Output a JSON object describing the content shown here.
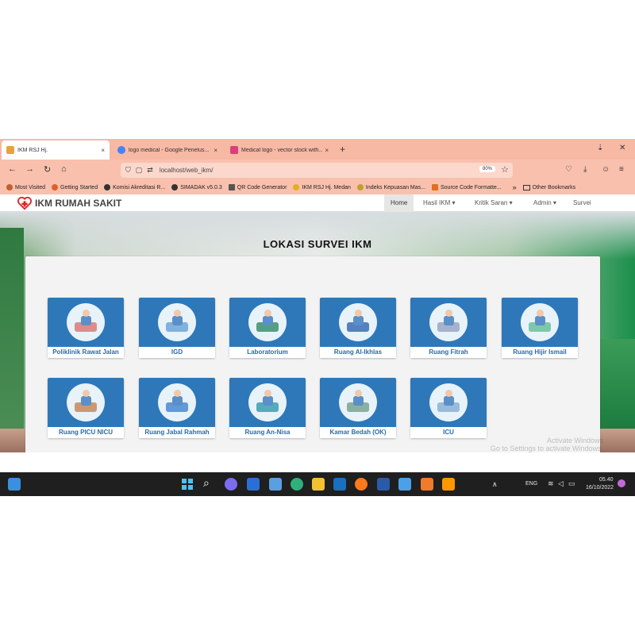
{
  "browser": {
    "tabs": [
      {
        "label": "IKM RSJ Hj.",
        "close": "×",
        "color": "#e8a33a"
      },
      {
        "label": "logo medical - Google Penelus...",
        "close": "×",
        "color": "#4285f4"
      },
      {
        "label": "Medical logo - vector stock with...",
        "close": "×",
        "color": "#d9407a"
      }
    ],
    "new_tab": "+",
    "window_controls": {
      "minimize": "⇣",
      "close": "✕"
    },
    "nav": {
      "back": "←",
      "forward": "→",
      "reload": "↻",
      "home": "⌂"
    },
    "url": "localhost/web_ikm/",
    "url_badge": "80%",
    "toolbar_icons": {
      "pocket": "♡",
      "download": "⤓",
      "extension": "☺",
      "menu": "≡"
    }
  },
  "bookmarks": {
    "items": [
      {
        "label": "Most Visited",
        "color": "#c06030"
      },
      {
        "label": "Getting Started",
        "color": "#e0602a"
      },
      {
        "label": "Komisi Akreditasi R...",
        "color": "#333333"
      },
      {
        "label": "SIMADAK v5.0.3",
        "color": "#333333"
      },
      {
        "label": "QR Code Generator",
        "color": "#555555"
      },
      {
        "label": "IKM RSJ Hj. Medan",
        "color": "#e0b020"
      },
      {
        "label": "Indeks Kepuasan Mas...",
        "color": "#c0a030"
      },
      {
        "label": "Source Code Formatte...",
        "color": "#e07020"
      }
    ],
    "more": "»",
    "other": "Other Bookmarks"
  },
  "site": {
    "brand": "IKM RUMAH SAKIT",
    "nav": [
      {
        "label": "Home"
      },
      {
        "label": "Hasil IKM ▾"
      },
      {
        "label": "Kritik Saran ▾"
      },
      {
        "label": "Admin ▾"
      },
      {
        "label": "Survei"
      }
    ],
    "title": "LOKASI SURVEI IKM",
    "watermark": "Activate Windows\nGo to Settings to activate Windows.",
    "cards": [
      {
        "label": "Poliklinik Rawat Jalan",
        "icon": "wheelchair-nurse"
      },
      {
        "label": "IGD",
        "icon": "emergency-room"
      },
      {
        "label": "Laboratorium",
        "icon": "lab-flask"
      },
      {
        "label": "Ruang Al-Ikhlas",
        "icon": "patient-bed"
      },
      {
        "label": "Ruang Fitrah",
        "icon": "patient-bed"
      },
      {
        "label": "Ruang Hijir Ismail",
        "icon": "patient-bed"
      },
      {
        "label": "Ruang PICU NICU",
        "icon": "child-patient"
      },
      {
        "label": "Ruang Jabal Rahmah",
        "icon": "doctor-patient"
      },
      {
        "label": "Ruang An-Nisa",
        "icon": "hospital-ward"
      },
      {
        "label": "Kamar Bedah (OK)",
        "icon": "operating-room"
      },
      {
        "label": "ICU",
        "icon": "icu-bed"
      }
    ]
  },
  "taskbar": {
    "lang": "ENG",
    "time": "05.40",
    "date": "16/10/2022",
    "tray": "∧"
  }
}
